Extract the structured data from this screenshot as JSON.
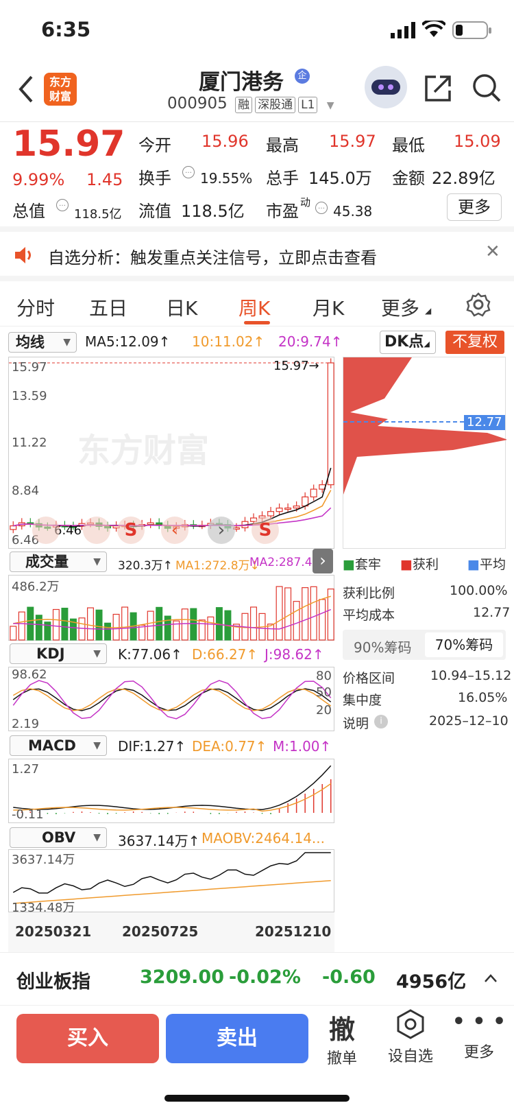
{
  "status": {
    "time": "6:35"
  },
  "header": {
    "logo_line1": "东方",
    "logo_line2": "财富",
    "name": "厦门港务",
    "badge": "企",
    "code": "000905",
    "tags": [
      "融",
      "深股通",
      "L1"
    ]
  },
  "quote": {
    "price": "15.97",
    "pct": "9.99%",
    "chg": "1.45",
    "open_label": "今开",
    "open": "15.96",
    "high_label": "最高",
    "high": "15.97",
    "low_label": "最低",
    "low": "15.09",
    "turnover_label": "换手",
    "turnover": "19.55%",
    "vol_label": "总手",
    "vol": "145.0万",
    "amount_label": "金额",
    "amount": "22.89亿",
    "mktcap_label": "总值",
    "mktcap": "118.5亿",
    "float_label": "流值",
    "float": "118.5亿",
    "pe_label": "市盈",
    "pe_sup": "动",
    "pe": "45.38",
    "more": "更多"
  },
  "notice": {
    "text": "自选分析：触发重点关注信号，立即点击查看"
  },
  "tabs": [
    "分时",
    "五日",
    "日K",
    "周K",
    "月K",
    "更多"
  ],
  "main_chart": {
    "indicator": "均线",
    "ma5": "MA5:12.09↑",
    "ma10": "10:11.02↑",
    "ma20": "20:9.74↑",
    "dk": "DK点",
    "fq": "不复权",
    "y_labels": [
      "15.97",
      "13.59",
      "11.22",
      "8.84",
      "6.46"
    ],
    "last_label": "15.97→",
    "low_label": "6.46",
    "watermark": "东方财富",
    "cost_tag": "12.77"
  },
  "volume": {
    "selector": "成交量",
    "v": "320.3万↑",
    "ma1": "MA1:272.8万↓",
    "ma2": "MA2:287.4...",
    "top": "486.2万"
  },
  "kdj": {
    "selector": "KDJ",
    "k": "K:77.06↑",
    "d": "D:66.27↑",
    "j": "J:98.62↑",
    "top": "98.62",
    "bot": "2.19",
    "lv80": "80",
    "lv50": "50",
    "lv20": "20"
  },
  "macd": {
    "selector": "MACD",
    "dif": "DIF:1.27↑",
    "dea": "DEA:0.77↑",
    "m": "M:1.00↑",
    "top": "1.27",
    "bot": "-0.11"
  },
  "obv": {
    "selector": "OBV",
    "v": "3637.14万↑",
    "ma": "MAOBV:2464.14...",
    "top": "3637.14万",
    "bot": "1334.48万"
  },
  "dates": [
    "20250321",
    "20250725",
    "20251210"
  ],
  "chips": {
    "legend": [
      "套牢",
      "获利",
      "平均"
    ],
    "rows": [
      [
        "获利比例",
        "100.00%"
      ],
      [
        "平均成本",
        "12.77"
      ]
    ],
    "tabs": [
      "90%筹码",
      "70%筹码"
    ],
    "rows2": [
      [
        "价格区间",
        "10.94–15.12"
      ],
      [
        "集中度",
        "16.05%"
      ],
      [
        "说明",
        "2025–12–10"
      ]
    ]
  },
  "index_bar": {
    "name": "创业板指",
    "value": "3209.00",
    "pct": "-0.02%",
    "chg": "-0.60",
    "amount": "4956亿"
  },
  "bottom": {
    "buy": "买入",
    "sell": "卖出",
    "cancel_icon": "撤",
    "cancel": "撤单",
    "watch": "设自选",
    "more": "更多"
  },
  "colors": {
    "up": "#e0352b",
    "down": "#2a9d3a",
    "accent": "#e8532a",
    "sell": "#4a7cf0"
  }
}
